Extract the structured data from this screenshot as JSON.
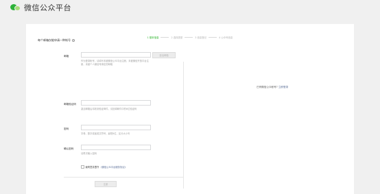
{
  "header": {
    "logo_icon": "wechat-logo",
    "title": "微信公众平台"
  },
  "steps": [
    {
      "label": "1 基本信息",
      "active": true
    },
    {
      "label": "2 选择类型",
      "active": false
    },
    {
      "label": "3 信息登记",
      "active": false
    },
    {
      "label": "4 公众号信息",
      "active": false
    }
  ],
  "form": {
    "intro": "每个邮箱仅能申请一种帐号",
    "help_icon": "?",
    "email": {
      "label": "邮箱",
      "value": "",
      "placeholder": "",
      "activate_button": "激活邮箱",
      "hint": "作为登录帐号，请填写未被微信公众平台注册，未被微信开放平台注册，未被个人微信号绑定的邮箱"
    },
    "email_code": {
      "label": "邮箱验证码",
      "value": "",
      "hint": "激活邮箱后将收到验证邮件，请回填邮件中的6位验证码"
    },
    "password": {
      "label": "密码",
      "value": "",
      "hint": "字母、数字或者英文符号，最短8位，区分大小写"
    },
    "confirm_password": {
      "label": "确认密码",
      "value": "",
      "hint": "请再次输入密码"
    },
    "agree_text": "我同意并遵守",
    "agree_link": "《微信公众平台服务协议》",
    "agree_checked": false,
    "register_button": "注册"
  },
  "right": {
    "text": "已有微信公众帐号?",
    "link": "立即登录"
  },
  "colors": {
    "accent": "#1aad19",
    "link": "#576b95",
    "background": "#f0f0f0"
  }
}
